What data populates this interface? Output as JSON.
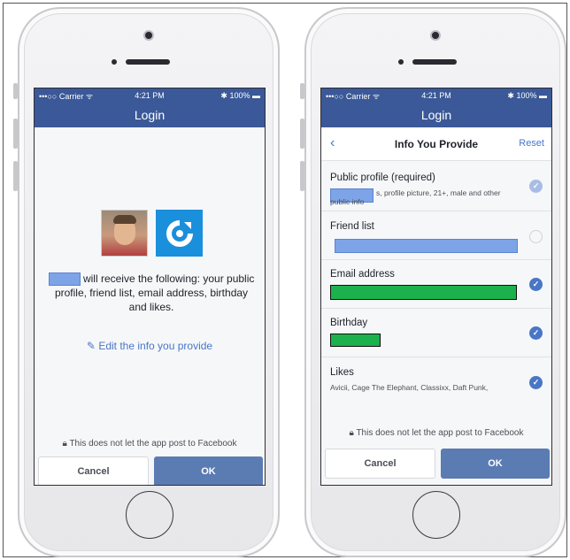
{
  "status": {
    "carrier": "•••○○ Carrier ᯤ",
    "time": "4:21 PM",
    "battery": "✱ 100% ▬"
  },
  "nav_title": "Login",
  "left": {
    "permission_text": "will receive the following: your public profile, friend list, email address, birthday and likes.",
    "edit_link": "Edit the info you provide",
    "notice": "This does not let the app post to Facebook",
    "cancel": "Cancel",
    "ok": "OK"
  },
  "right": {
    "back": "‹",
    "title": "Info You Provide",
    "reset": "Reset",
    "items": [
      {
        "title": "Public profile (required)",
        "sub": "s, profile picture, 21+, male and other public info",
        "state": "required"
      },
      {
        "title": "Friend list",
        "sub": "",
        "state": "off"
      },
      {
        "title": "Email address",
        "sub": "",
        "state": "on"
      },
      {
        "title": "Birthday",
        "sub": "",
        "state": "on"
      },
      {
        "title": "Likes",
        "sub": "Avicii, Cage The Elephant, Classixx, Daft Punk,",
        "state": "on"
      }
    ],
    "notice": "This does not let the app post to Facebook",
    "cancel": "Cancel",
    "ok": "OK"
  },
  "colors": {
    "facebook_blue": "#3b5998",
    "link_blue": "#4a76c6",
    "redaction_green": "#1bb14c",
    "redaction_blue": "#7ea4e8"
  },
  "icons": [
    "pencil-icon",
    "lock-icon",
    "checkmark-icon",
    "back-chevron-icon",
    "app-logo-icon"
  ]
}
